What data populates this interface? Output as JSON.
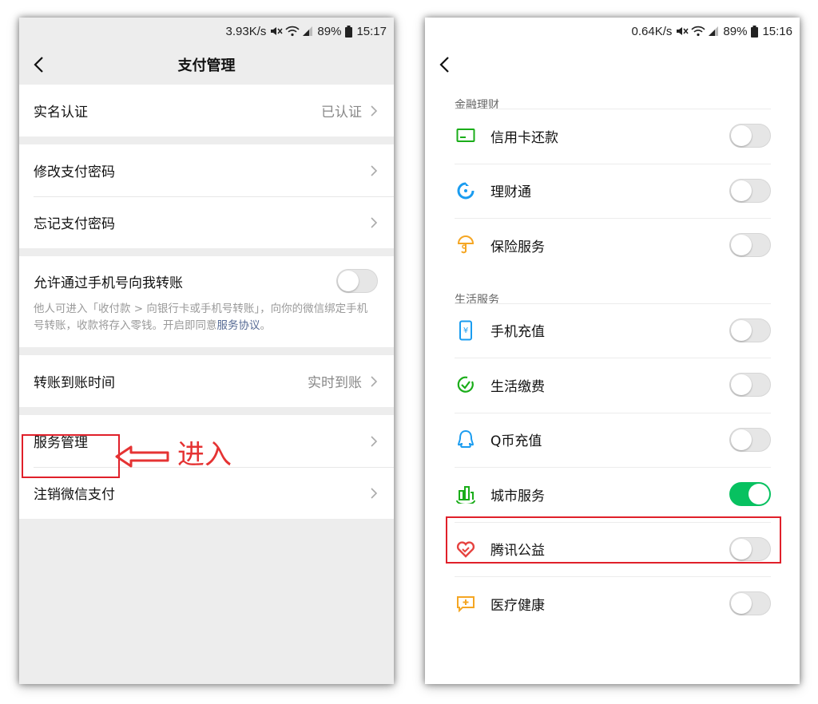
{
  "left": {
    "status": {
      "speed": "3.93K/s",
      "battery": "89%",
      "time": "15:17"
    },
    "title": "支付管理",
    "realname": {
      "label": "实名认证",
      "value": "已认证"
    },
    "change_password": "修改支付密码",
    "forgot_password": "忘记支付密码",
    "phone_transfer": {
      "label": "允许通过手机号向我转账",
      "desc_before": "他人可进入「收付款 > 向银行卡或手机号转账」，向你的微信绑定手机号转账，收款将存入零钱。开启即同意",
      "desc_link": "服务协议",
      "desc_after": "。",
      "enabled": false
    },
    "arrival_time": {
      "label": "转账到账时间",
      "value": "实时到账"
    },
    "service_manage": "服务管理",
    "close_pay": "注销微信支付",
    "annotation": "进入"
  },
  "right": {
    "status": {
      "speed": "0.64K/s",
      "battery": "89%",
      "time": "15:16"
    },
    "sections": [
      {
        "title": "金融理财",
        "items": [
          {
            "label": "信用卡还款",
            "icon": "credit-card-icon",
            "enabled": false
          },
          {
            "label": "理财通",
            "icon": "wealth-icon",
            "enabled": false
          },
          {
            "label": "保险服务",
            "icon": "insurance-icon",
            "enabled": false
          }
        ]
      },
      {
        "title": "生活服务",
        "items": [
          {
            "label": "手机充值",
            "icon": "phone-recharge-icon",
            "enabled": false
          },
          {
            "label": "生活缴费",
            "icon": "utility-payment-icon",
            "enabled": false
          },
          {
            "label": "Q币充值",
            "icon": "qq-coin-icon",
            "enabled": false
          },
          {
            "label": "城市服务",
            "icon": "city-service-icon",
            "enabled": true
          },
          {
            "label": "腾讯公益",
            "icon": "charity-icon",
            "enabled": false
          },
          {
            "label": "医疗健康",
            "icon": "medical-icon",
            "enabled": false
          }
        ]
      }
    ]
  },
  "colors": {
    "wechat_green": "#07c160",
    "highlight_red": "#e0202a",
    "link_blue": "#576b95"
  }
}
